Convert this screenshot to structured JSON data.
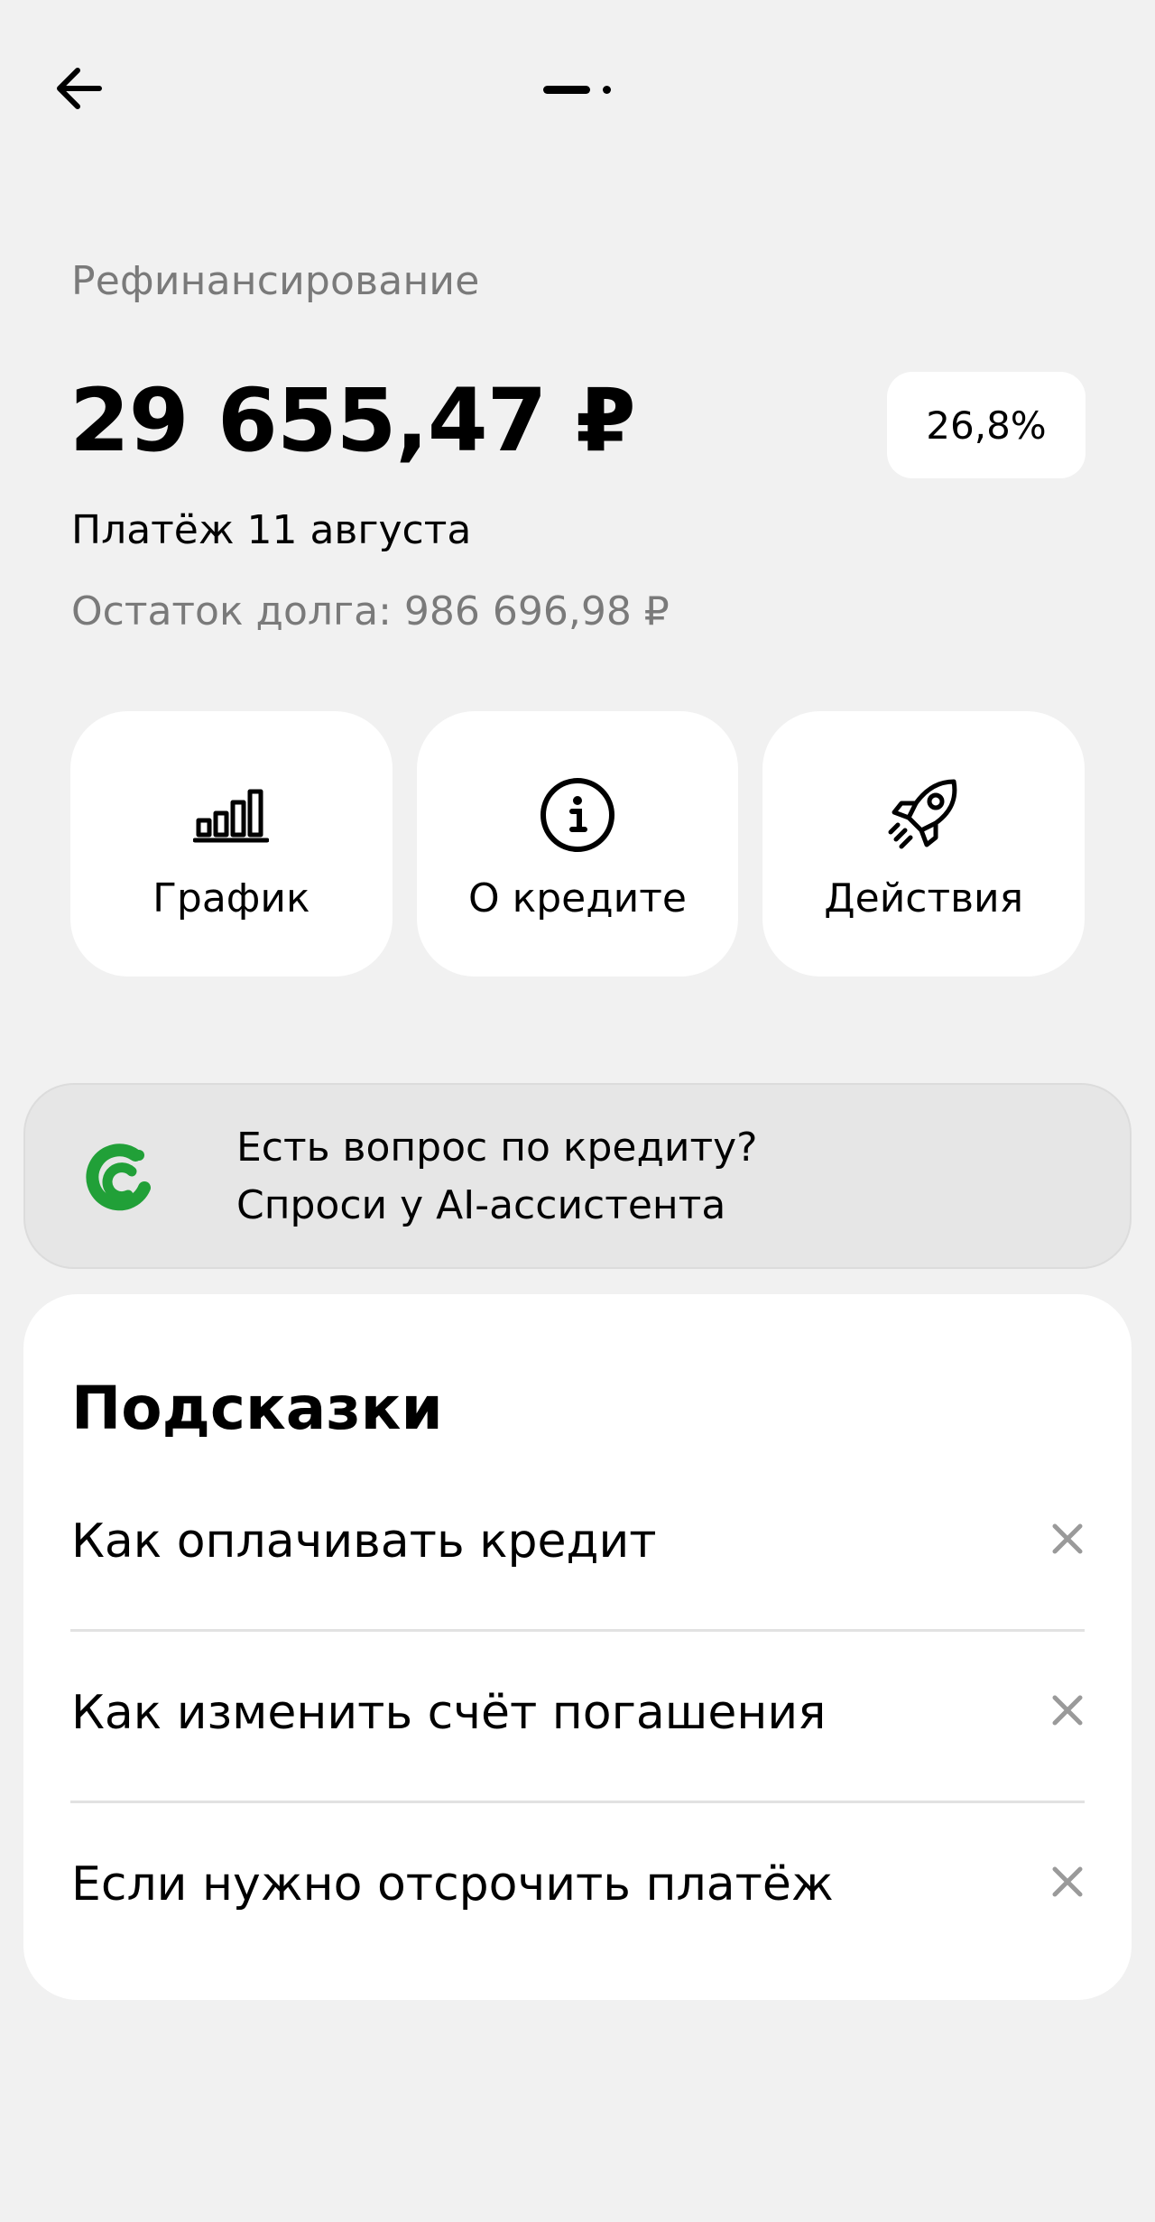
{
  "header": {
    "back_icon": "arrow-left-icon",
    "pager_icon": "page-indicator"
  },
  "loan": {
    "title": "Рефинансирование",
    "amount": "29 655,47 ₽",
    "rate": "26,8%",
    "payment_date": "Платёж 11 августа",
    "debt_left": "Остаток долга: 986 696,98 ₽"
  },
  "actions": [
    {
      "label": "График",
      "icon": "bar-chart-icon"
    },
    {
      "label": "О кредите",
      "icon": "info-icon"
    },
    {
      "label": "Действия",
      "icon": "rocket-icon"
    }
  ],
  "ai_banner": {
    "line1": "Есть вопрос по кредиту?",
    "line2": "Спроси у AI-ассистента",
    "logo_icon": "sber-logo-icon",
    "logo_color": "#21a038"
  },
  "tips": {
    "title": "Подсказки",
    "items": [
      {
        "label": "Как оплачивать кредит"
      },
      {
        "label": "Как изменить счёт погашения"
      },
      {
        "label": "Если нужно отсрочить платёж"
      }
    ]
  }
}
